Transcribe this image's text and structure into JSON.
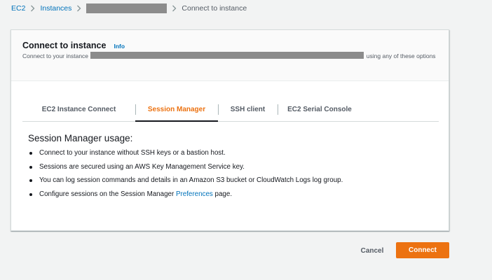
{
  "breadcrumb": {
    "root": "EC2",
    "instances": "Instances",
    "current": "Connect to instance"
  },
  "card": {
    "title": "Connect to instance",
    "info": "Info",
    "desc_prefix": "Connect to your instance",
    "desc_suffix": "using any of these options"
  },
  "tabs": [
    {
      "label": "EC2 Instance Connect",
      "active": false
    },
    {
      "label": "Session Manager",
      "active": true
    },
    {
      "label": "SSH client",
      "active": false
    },
    {
      "label": "EC2 Serial Console",
      "active": false
    }
  ],
  "session_manager": {
    "heading": "Session Manager usage:",
    "bullets": [
      "Connect to your instance without SSH keys or a bastion host.",
      "Sessions are secured using an AWS Key Management Service key.",
      "You can log session commands and details in an Amazon S3 bucket or CloudWatch Logs log group."
    ],
    "last_bullet": {
      "prefix": "Configure sessions on the Session Manager ",
      "link": "Preferences",
      "suffix": " page."
    }
  },
  "actions": {
    "cancel": "Cancel",
    "connect": "Connect"
  },
  "colors": {
    "accent": "#ec7211",
    "link": "#0073bb",
    "redaction": "#8c8c8c"
  }
}
